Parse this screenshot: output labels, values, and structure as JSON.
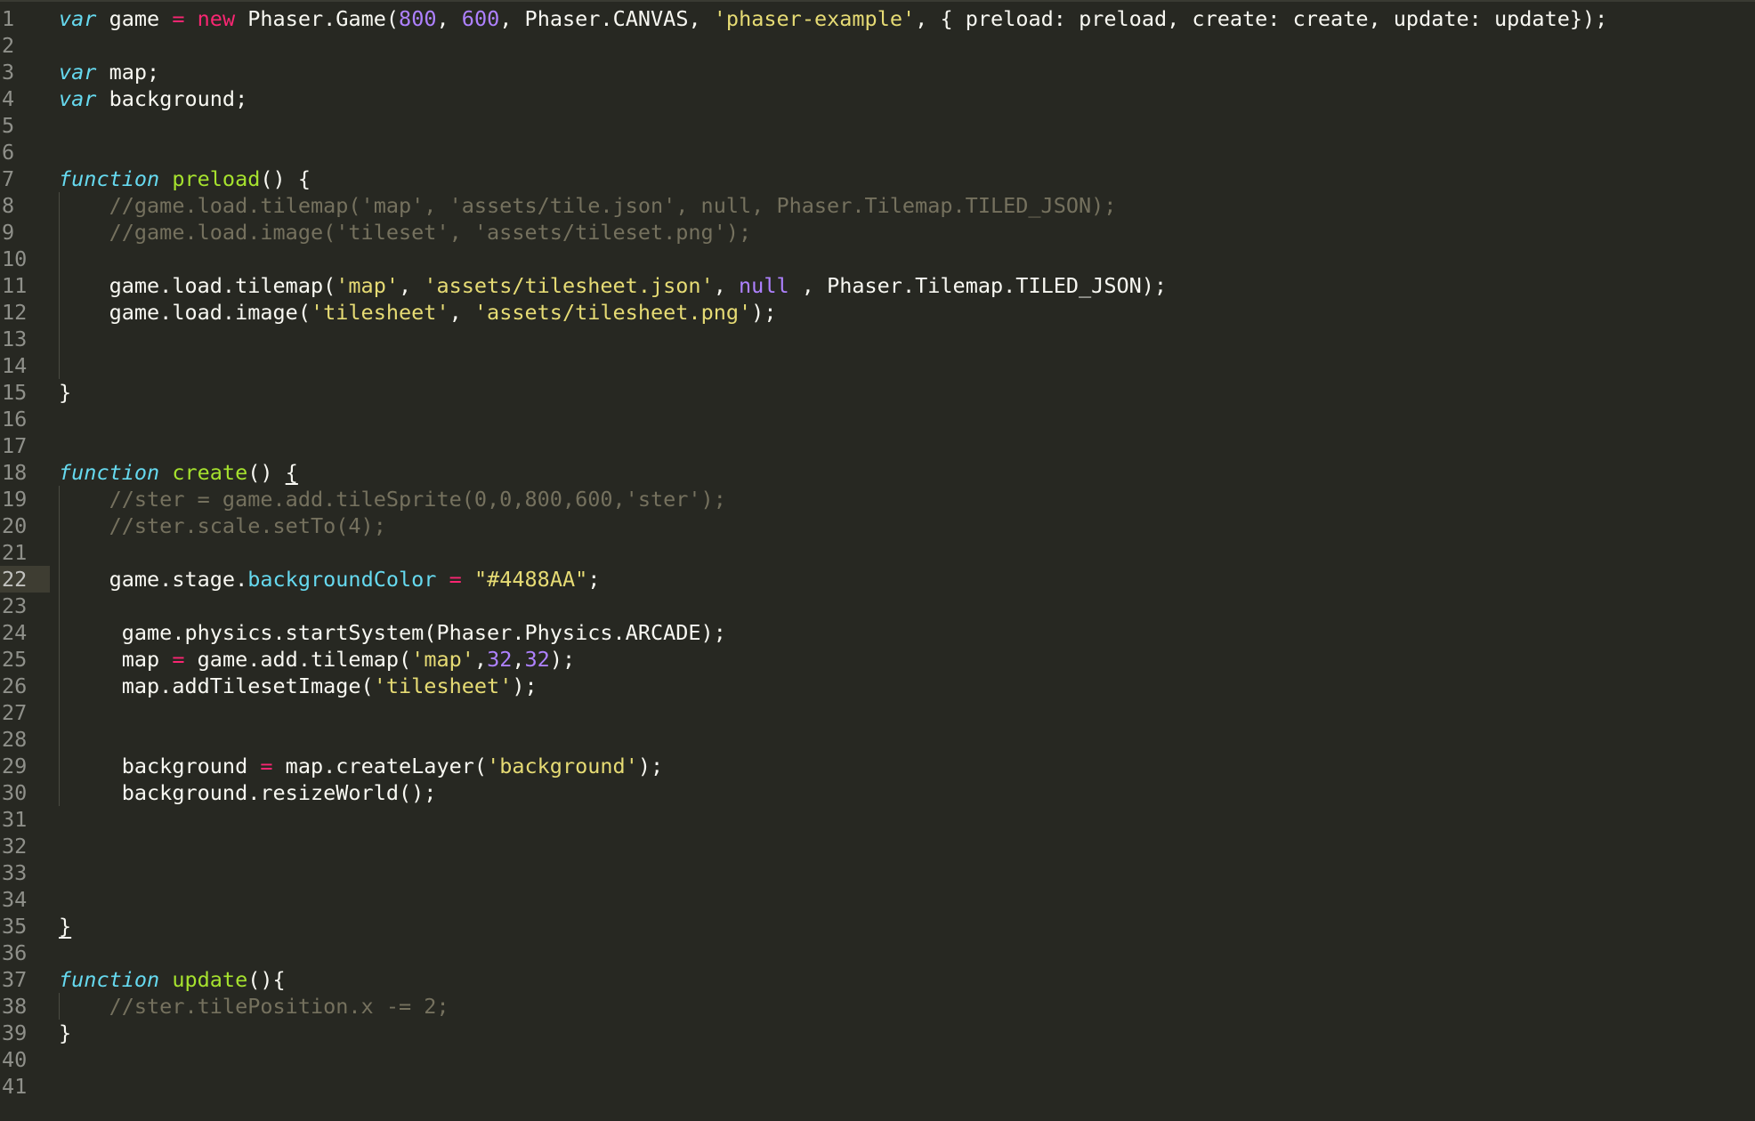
{
  "editor": {
    "theme": {
      "background": "#272822",
      "gutter_text": "#8f908a",
      "current_line_gutter": "#3e3d32",
      "storage": "#66d9ef",
      "keyword": "#f92672",
      "number": "#ae81ff",
      "string": "#e6db74",
      "function_name": "#a6e22e",
      "comment": "#75715e",
      "text": "#f8f8f2"
    },
    "current_line": 22,
    "lines": [
      {
        "num": "1",
        "tokens": [
          [
            "storage",
            "var"
          ],
          [
            "plain",
            " game "
          ],
          [
            "kw",
            "="
          ],
          [
            "plain",
            " "
          ],
          [
            "kw",
            "new"
          ],
          [
            "plain",
            " Phaser.Game("
          ],
          [
            "num",
            "800"
          ],
          [
            "plain",
            ", "
          ],
          [
            "num",
            "600"
          ],
          [
            "plain",
            ", Phaser.CANVAS, "
          ],
          [
            "str",
            "'phaser-example'"
          ],
          [
            "plain",
            ", { preload: preload, create: create, update: update});"
          ]
        ]
      },
      {
        "num": "2",
        "tokens": []
      },
      {
        "num": "3",
        "tokens": [
          [
            "storage",
            "var"
          ],
          [
            "plain",
            " map;"
          ]
        ]
      },
      {
        "num": "4",
        "tokens": [
          [
            "storage",
            "var"
          ],
          [
            "plain",
            " background;"
          ]
        ]
      },
      {
        "num": "5",
        "tokens": []
      },
      {
        "num": "6",
        "tokens": []
      },
      {
        "num": "7",
        "tokens": [
          [
            "storage",
            "function"
          ],
          [
            "plain",
            " "
          ],
          [
            "fn",
            "preload"
          ],
          [
            "plain",
            "() {"
          ]
        ]
      },
      {
        "num": "8",
        "guide": true,
        "tokens": [
          [
            "comment",
            "    //game.load.tilemap('map', 'assets/tile.json', null, Phaser.Tilemap.TILED_JSON);"
          ]
        ]
      },
      {
        "num": "9",
        "guide": true,
        "tokens": [
          [
            "comment",
            "    //game.load.image('tileset', 'assets/tileset.png');"
          ]
        ]
      },
      {
        "num": "10",
        "guide": true,
        "tokens": []
      },
      {
        "num": "11",
        "guide": true,
        "tokens": [
          [
            "plain",
            "    game.load.tilemap("
          ],
          [
            "str",
            "'map'"
          ],
          [
            "plain",
            ", "
          ],
          [
            "str",
            "'assets/tilesheet.json'"
          ],
          [
            "plain",
            ", "
          ],
          [
            "num",
            "null"
          ],
          [
            "plain",
            " , Phaser.Tilemap.TILED_JSON);"
          ]
        ]
      },
      {
        "num": "12",
        "guide": true,
        "tokens": [
          [
            "plain",
            "    game.load.image("
          ],
          [
            "str",
            "'tilesheet'"
          ],
          [
            "plain",
            ", "
          ],
          [
            "str",
            "'assets/tilesheet.png'"
          ],
          [
            "plain",
            ");"
          ]
        ]
      },
      {
        "num": "13",
        "guide": true,
        "tokens": []
      },
      {
        "num": "14",
        "guide": true,
        "tokens": []
      },
      {
        "num": "15",
        "tokens": [
          [
            "plain",
            "}"
          ]
        ]
      },
      {
        "num": "16",
        "tokens": []
      },
      {
        "num": "17",
        "tokens": []
      },
      {
        "num": "18",
        "tokens": [
          [
            "storage",
            "function"
          ],
          [
            "plain",
            " "
          ],
          [
            "fn",
            "create"
          ],
          [
            "plain",
            "() "
          ],
          [
            "ul",
            "{"
          ]
        ]
      },
      {
        "num": "19",
        "guide": true,
        "tokens": [
          [
            "comment",
            "    //ster = game.add.tileSprite(0,0,800,600,'ster');"
          ]
        ]
      },
      {
        "num": "20",
        "guide": true,
        "tokens": [
          [
            "comment",
            "    //ster.scale.setTo(4);"
          ]
        ]
      },
      {
        "num": "21",
        "guide": true,
        "tokens": []
      },
      {
        "num": "22",
        "guide": true,
        "tokens": [
          [
            "plain",
            "    game.stage."
          ],
          [
            "prop",
            "backgroundColor"
          ],
          [
            "plain",
            " "
          ],
          [
            "kw",
            "="
          ],
          [
            "plain",
            " "
          ],
          [
            "str",
            "\"#4488AA\""
          ],
          [
            "plain",
            ";"
          ]
        ]
      },
      {
        "num": "23",
        "guide": true,
        "tokens": []
      },
      {
        "num": "24",
        "guide": true,
        "tokens": [
          [
            "plain",
            "     game.physics.startSystem(Phaser.Physics.ARCADE);"
          ]
        ]
      },
      {
        "num": "25",
        "guide": true,
        "tokens": [
          [
            "plain",
            "     map "
          ],
          [
            "kw",
            "="
          ],
          [
            "plain",
            " game.add.tilemap("
          ],
          [
            "str",
            "'map'"
          ],
          [
            "plain",
            ","
          ],
          [
            "num",
            "32"
          ],
          [
            "plain",
            ","
          ],
          [
            "num",
            "32"
          ],
          [
            "plain",
            ");"
          ]
        ]
      },
      {
        "num": "26",
        "guide": true,
        "tokens": [
          [
            "plain",
            "     map.addTilesetImage("
          ],
          [
            "str",
            "'tilesheet'"
          ],
          [
            "plain",
            ");"
          ]
        ]
      },
      {
        "num": "27",
        "guide": true,
        "tokens": []
      },
      {
        "num": "28",
        "guide": true,
        "tokens": []
      },
      {
        "num": "29",
        "guide": true,
        "tokens": [
          [
            "plain",
            "     background "
          ],
          [
            "kw",
            "="
          ],
          [
            "plain",
            " map.createLayer("
          ],
          [
            "str",
            "'background'"
          ],
          [
            "plain",
            ");"
          ]
        ]
      },
      {
        "num": "30",
        "guide": true,
        "tokens": [
          [
            "plain",
            "     background.resizeWorld();"
          ]
        ]
      },
      {
        "num": "31",
        "tokens": []
      },
      {
        "num": "32",
        "tokens": []
      },
      {
        "num": "33",
        "tokens": []
      },
      {
        "num": "34",
        "tokens": []
      },
      {
        "num": "35",
        "tokens": [
          [
            "ul",
            "}"
          ]
        ]
      },
      {
        "num": "36",
        "tokens": []
      },
      {
        "num": "37",
        "tokens": [
          [
            "storage",
            "function"
          ],
          [
            "plain",
            " "
          ],
          [
            "fn",
            "update"
          ],
          [
            "plain",
            "(){"
          ]
        ]
      },
      {
        "num": "38",
        "guide": true,
        "tokens": [
          [
            "comment",
            "    //ster.tilePosition.x -= 2;"
          ]
        ]
      },
      {
        "num": "39",
        "tokens": [
          [
            "plain",
            "}"
          ]
        ]
      },
      {
        "num": "40",
        "tokens": []
      },
      {
        "num": "41",
        "tokens": []
      }
    ]
  }
}
